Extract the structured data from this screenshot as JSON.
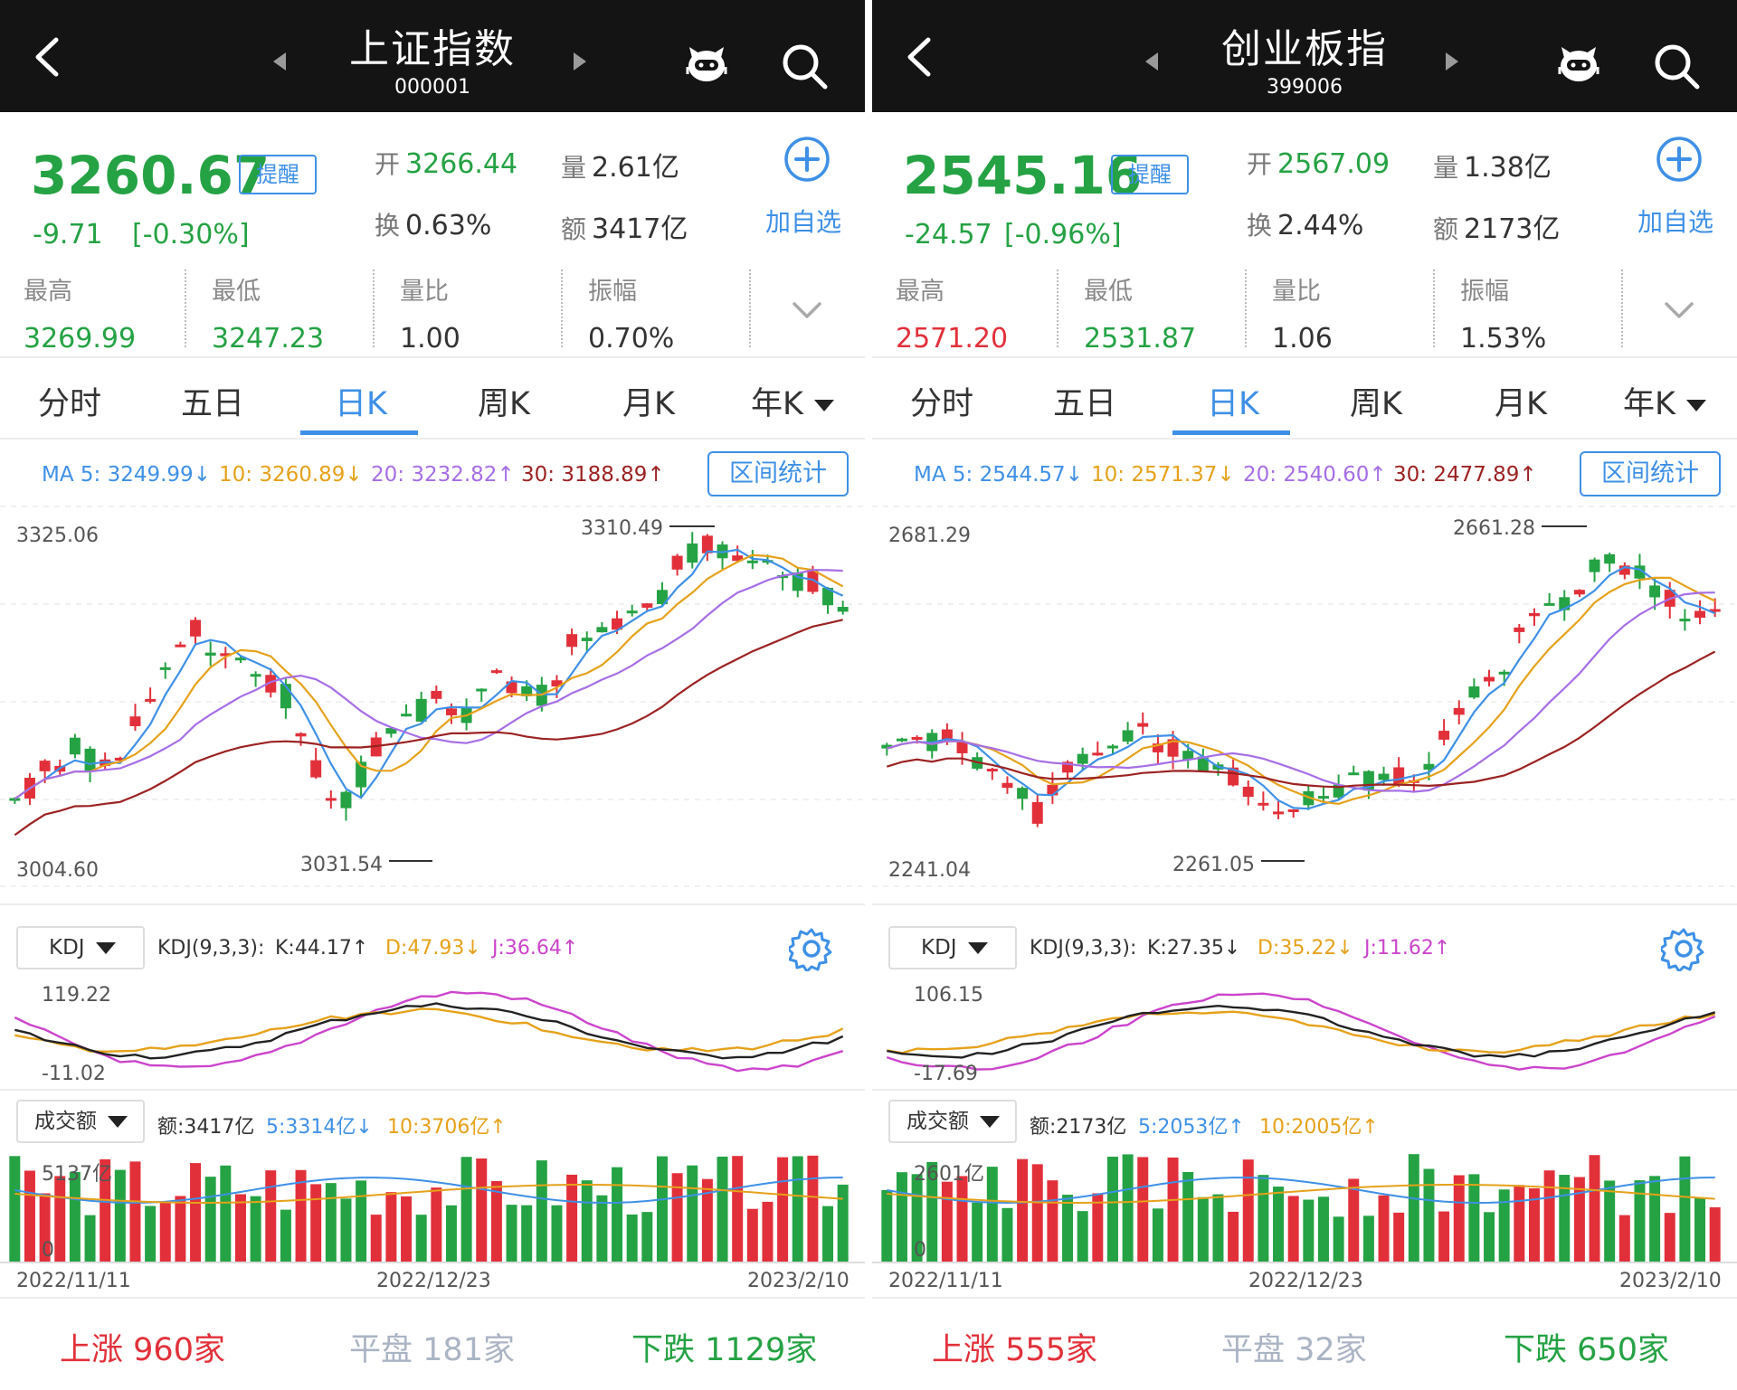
{
  "colors": {
    "up": "#e2303a",
    "down": "#25a244",
    "accent": "#3e90e6",
    "ma5": "#3e90e6",
    "ma10": "#e6a11a",
    "ma20": "#a66ee6",
    "ma30": "#9c2222",
    "kdj_k": "#222222",
    "kdj_d": "#e6a11a",
    "kdj_j": "#cc44cc"
  },
  "panels": [
    {
      "title": "上证指数",
      "code": "000001",
      "price": "3260.67",
      "remind": "提醒",
      "change": "-9.71",
      "change_pct": "[-0.30%]",
      "open_k": "开",
      "open": "3266.44",
      "vol_k": "量",
      "vol": "2.61亿",
      "turn_k": "换",
      "turn": "0.63%",
      "amt_k": "额",
      "amt": "3417亿",
      "add_fav": "加自选",
      "stats": [
        {
          "label": "最高",
          "value": "3269.99"
        },
        {
          "label": "最低",
          "value": "3247.23"
        },
        {
          "label": "量比",
          "value": "1.00"
        },
        {
          "label": "振幅",
          "value": "0.70%"
        }
      ],
      "tabs": [
        "分时",
        "五日",
        "日K",
        "周K",
        "月K",
        "年K"
      ],
      "ma": {
        "ma5": "MA 5: 3249.99↓",
        "ma10": "10: 3260.89↓",
        "ma20": "20: 3232.82↑",
        "ma30": "30: 3188.89↑"
      },
      "range_btn": "区间统计",
      "chart": {
        "top_label": "3325.06",
        "bottom_label": "3004.60",
        "max_label": "3310.49",
        "min_label": "3031.54"
      },
      "kdj_btn": "KDJ",
      "kdj_params": "KDJ(9,3,3):",
      "kdj_k": "K:44.17↑",
      "kdj_d": "D:47.93↓",
      "kdj_j": "J:36.64↑",
      "kdj_top": "119.22",
      "kdj_bottom": "-11.02",
      "vol_btn": "成交额",
      "vol_amt": "额:3417亿",
      "vol_ma5": "5:3314亿↓",
      "vol_ma10": "10:3706亿↑",
      "vol_top": "5137亿",
      "vol_zero": "0",
      "dates": [
        "2022/11/11",
        "2022/12/23",
        "2023/2/10"
      ],
      "up_k": "上涨",
      "up": "960家",
      "flat_k": "平盘",
      "flat": "181家",
      "down_k": "下跌",
      "down": "1129家"
    },
    {
      "title": "创业板指",
      "code": "399006",
      "price": "2545.16",
      "remind": "提醒",
      "change": "-24.57",
      "change_pct": "[-0.96%]",
      "open_k": "开",
      "open": "2567.09",
      "vol_k": "量",
      "vol": "1.38亿",
      "turn_k": "换",
      "turn": "2.44%",
      "amt_k": "额",
      "amt": "2173亿",
      "add_fav": "加自选",
      "stats": [
        {
          "label": "最高",
          "value": "2571.20"
        },
        {
          "label": "最低",
          "value": "2531.87"
        },
        {
          "label": "量比",
          "value": "1.06"
        },
        {
          "label": "振幅",
          "value": "1.53%"
        }
      ],
      "tabs": [
        "分时",
        "五日",
        "日K",
        "周K",
        "月K",
        "年K"
      ],
      "ma": {
        "ma5": "MA 5: 2544.57↓",
        "ma10": "10: 2571.37↓",
        "ma20": "20: 2540.60↑",
        "ma30": "30: 2477.89↑"
      },
      "range_btn": "区间统计",
      "chart": {
        "top_label": "2681.29",
        "bottom_label": "2241.04",
        "max_label": "2661.28",
        "min_label": "2261.05"
      },
      "kdj_btn": "KDJ",
      "kdj_params": "KDJ(9,3,3):",
      "kdj_k": "K:27.35↓",
      "kdj_d": "D:35.22↓",
      "kdj_j": "J:11.62↑",
      "kdj_top": "106.15",
      "kdj_bottom": "-17.69",
      "vol_btn": "成交额",
      "vol_amt": "额:2173亿",
      "vol_ma5": "5:2053亿↑",
      "vol_ma10": "10:2005亿↑",
      "vol_top": "2601亿",
      "vol_zero": "0",
      "dates": [
        "2022/11/11",
        "2022/12/23",
        "2023/2/10"
      ],
      "up_k": "上涨",
      "up": "555家",
      "flat_k": "平盘",
      "flat": "32家",
      "down_k": "下跌",
      "down": "650家"
    }
  ]
}
